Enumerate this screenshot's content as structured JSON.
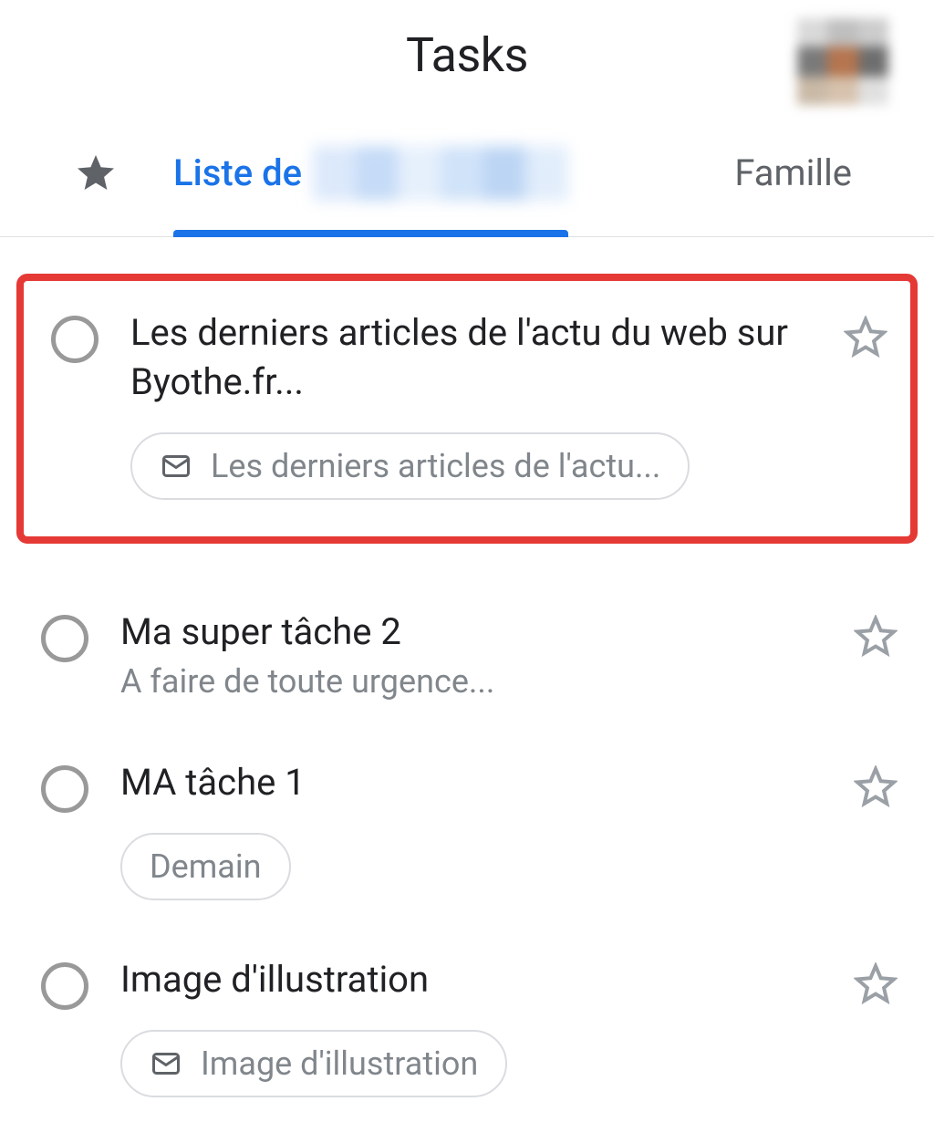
{
  "header": {
    "title": "Tasks"
  },
  "tabs": {
    "active_label": "Liste de",
    "family_label": "Famille"
  },
  "tasks": [
    {
      "title": "Les derniers articles de l'actu du web sur Byothe.fr...",
      "chip_text": "Les derniers articles de l'actu...",
      "has_mail_chip": true,
      "highlighted": true
    },
    {
      "title": "Ma super tâche 2",
      "subtitle": "A faire de toute urgence..."
    },
    {
      "title": "MA tâche 1",
      "date_chip": "Demain"
    },
    {
      "title": "Image d'illustration",
      "chip_text": "Image d'illustration",
      "has_mail_chip": true
    }
  ]
}
